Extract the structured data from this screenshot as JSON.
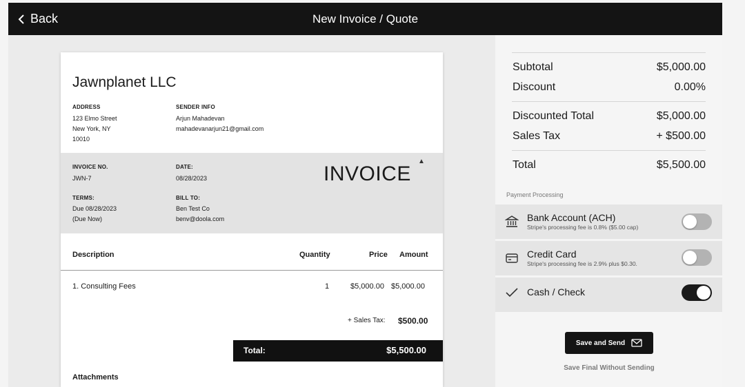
{
  "header": {
    "back_label": "Back",
    "title": "New Invoice / Quote"
  },
  "invoice": {
    "company": "Jawnplanet LLC",
    "address_label": "ADDRESS",
    "address_lines": [
      "123 Elmo Street",
      "New York, NY",
      "10010"
    ],
    "sender_label": "SENDER INFO",
    "sender_lines": [
      "Arjun Mahadevan",
      "mahadevanarjun21@gmail.com"
    ],
    "invoice_no_label": "INVOICE NO.",
    "invoice_no": "JWN-7",
    "date_label": "DATE:",
    "date": "08/28/2023",
    "heading": "INVOICE",
    "terms_label": "TERMS:",
    "terms_lines": [
      "Due 08/28/2023",
      "(Due Now)"
    ],
    "bill_to_label": "BILL TO:",
    "bill_to_lines": [
      "Ben Test Co",
      "benv@doola.com"
    ],
    "columns": {
      "description": "Description",
      "quantity": "Quantity",
      "price": "Price",
      "amount": "Amount"
    },
    "items": [
      {
        "description": "1. Consulting Fees",
        "quantity": "1",
        "price": "$5,000.00",
        "amount": "$5,000.00"
      }
    ],
    "sales_tax_label": "+ Sales Tax:",
    "sales_tax": "$500.00",
    "total_label": "Total:",
    "total": "$5,500.00",
    "attachments_label": "Attachments"
  },
  "summary": {
    "subtotal_label": "Subtotal",
    "subtotal": "$5,000.00",
    "discount_label": "Discount",
    "discount": "0.00%",
    "discounted_total_label": "Discounted Total",
    "discounted_total": "$5,000.00",
    "sales_tax_label": "Sales Tax",
    "sales_tax": "+ $500.00",
    "total_label": "Total",
    "total": "$5,500.00"
  },
  "payment": {
    "title": "Payment Processing",
    "methods": [
      {
        "name": "Bank Account (ACH)",
        "fee": "Stripe's processing fee is 0.8% ($5.00 cap)",
        "icon": "bank-icon",
        "enabled": false
      },
      {
        "name": "Credit Card",
        "fee": "Stripe's processing fee is 2.9% plus $0.30.",
        "icon": "credit-card-icon",
        "enabled": false
      },
      {
        "name": "Cash / Check",
        "fee": "",
        "icon": "check-icon",
        "enabled": true
      }
    ]
  },
  "actions": {
    "save_send": "Save and Send",
    "save_final": "Save Final Without Sending"
  }
}
